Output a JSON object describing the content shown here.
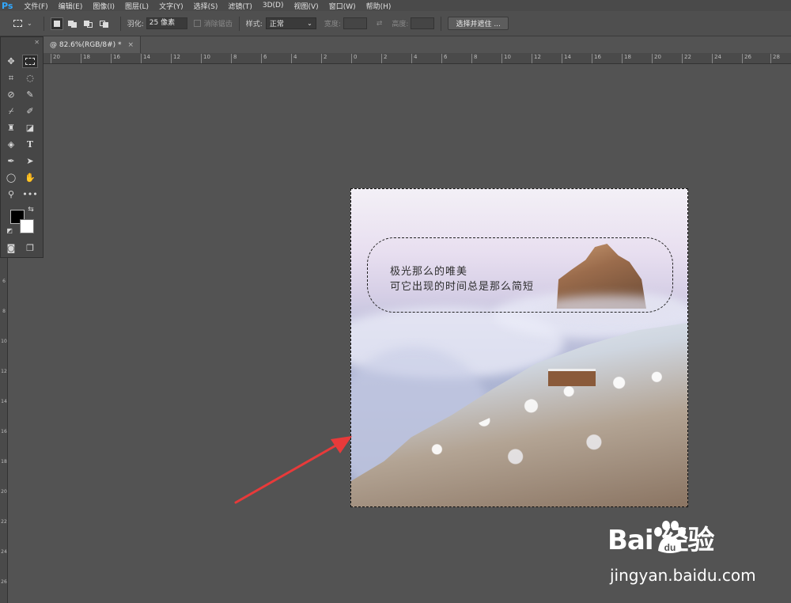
{
  "app": {
    "logo": "Ps"
  },
  "menubar": [
    "文件(F)",
    "编辑(E)",
    "图像(I)",
    "图层(L)",
    "文字(Y)",
    "选择(S)",
    "滤镜(T)",
    "3D(D)",
    "视图(V)",
    "窗口(W)",
    "帮助(H)"
  ],
  "options": {
    "feather_label": "羽化:",
    "feather_value": "25 像素",
    "antialias_label": "消除锯齿",
    "style_label": "样式:",
    "style_value": "正常",
    "width_label": "宽度:",
    "height_label": "高度:",
    "select_mask_button": "选择并遮住 ..."
  },
  "document_tab": {
    "title": "@ 82.6%(RGB/8#) *",
    "close": "×"
  },
  "ruler": {
    "h_labels": [
      "20",
      "18",
      "16",
      "14",
      "12",
      "10",
      "8",
      "6",
      "4",
      "2",
      "0",
      "2",
      "4",
      "6",
      "8",
      "10",
      "12",
      "14",
      "16",
      "18",
      "20",
      "22",
      "24",
      "26",
      "28"
    ],
    "v_labels": [
      "6",
      "8",
      "10",
      "12",
      "14",
      "16",
      "18",
      "20",
      "22",
      "24",
      "26"
    ]
  },
  "canvas": {
    "caption_line1": "极光那么的唯美",
    "caption_line2": "可它出现的时间总是那么简短"
  },
  "watermark": {
    "logo": "Bai  经验",
    "url": "jingyan.baidu.com"
  },
  "colors": {
    "foreground": "#000000",
    "background": "#ffffff",
    "arrow": "#e83a3a"
  }
}
